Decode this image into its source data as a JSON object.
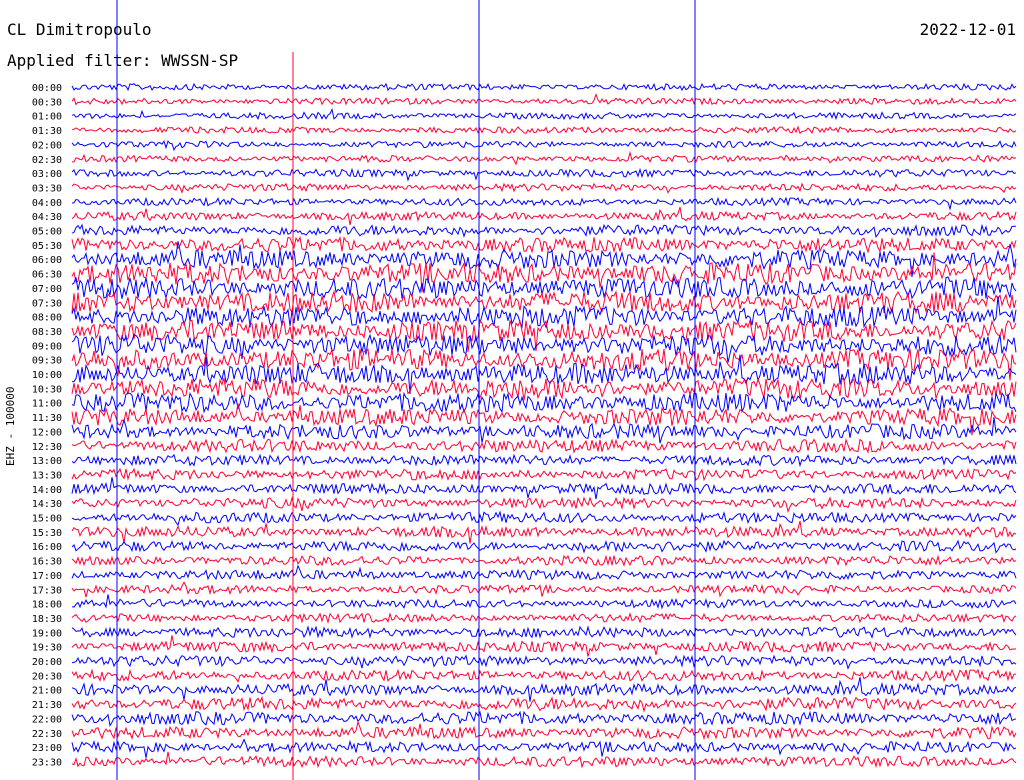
{
  "header": {
    "station": "CL Dimitropoulo",
    "filter": "Applied filter: WWSSN-SP",
    "date": "2022-12-01"
  },
  "channel_label": "EHZ - 100000",
  "chart_data": {
    "type": "line",
    "title": "CL Dimitropoulo",
    "subtitle": "Applied filter: WWSSN-SP",
    "date": "2022-12-01",
    "ylabel": "EHZ - 100000",
    "trace_colors": [
      "#0000ff",
      "#ff0033"
    ],
    "row_labels": [
      "00:00",
      "00:30",
      "01:00",
      "01:30",
      "02:00",
      "02:30",
      "03:00",
      "03:30",
      "04:00",
      "04:30",
      "05:00",
      "05:30",
      "06:00",
      "06:30",
      "07:00",
      "07:30",
      "08:00",
      "08:30",
      "09:00",
      "09:30",
      "10:00",
      "10:30",
      "11:00",
      "11:30",
      "12:00",
      "12:30",
      "13:00",
      "13:30",
      "14:00",
      "14:30",
      "15:00",
      "15:30",
      "16:00",
      "16:30",
      "17:00",
      "17:30",
      "18:00",
      "18:30",
      "19:00",
      "19:30",
      "20:00",
      "20:30",
      "21:00",
      "21:30",
      "22:00",
      "22:30",
      "23:00",
      "23:30"
    ],
    "noise_amplitude": [
      0.3,
      0.3,
      0.3,
      0.3,
      0.3,
      0.3,
      0.35,
      0.35,
      0.35,
      0.4,
      0.5,
      0.7,
      0.9,
      1.0,
      1.0,
      1.0,
      1.0,
      1.0,
      1.0,
      1.0,
      1.0,
      0.95,
      0.9,
      0.8,
      0.7,
      0.6,
      0.5,
      0.5,
      0.5,
      0.5,
      0.5,
      0.5,
      0.5,
      0.45,
      0.45,
      0.4,
      0.4,
      0.4,
      0.5,
      0.5,
      0.5,
      0.5,
      0.55,
      0.6,
      0.6,
      0.55,
      0.5,
      0.5
    ],
    "grid": false,
    "legend": "none"
  },
  "colors": {
    "trace_a": "#0000ff",
    "trace_b": "#ff0033",
    "background": "#ffffff",
    "text": "#000000"
  }
}
